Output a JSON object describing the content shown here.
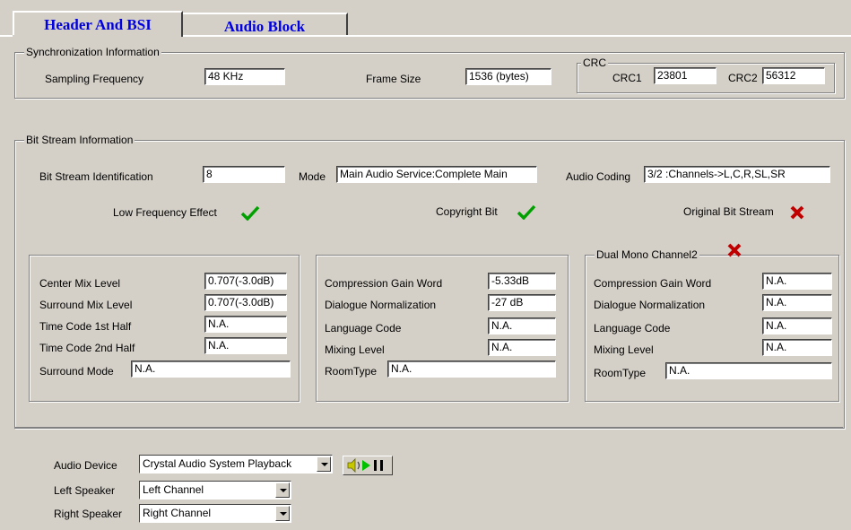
{
  "tabs": [
    {
      "label": "Header And BSI"
    },
    {
      "label": "Audio Block"
    }
  ],
  "sync": {
    "legend": "Synchronization  Information",
    "sampling_label": "Sampling Frequency",
    "sampling_value": "48 KHz",
    "frame_label": "Frame Size",
    "frame_value": "1536 (bytes)",
    "crc_legend": "CRC",
    "crc1_label": "CRC1",
    "crc1_value": "23801",
    "crc2_label": "CRC2",
    "crc2_value": "56312"
  },
  "bsi": {
    "legend": "Bit Stream Information",
    "bsid_label": "Bit Stream Identification",
    "bsid_value": "8",
    "mode_label": "Mode",
    "mode_value": "Main Audio Service:Complete Main",
    "coding_label": "Audio Coding",
    "coding_value": "3/2 :Channels->L,C,R,SL,SR",
    "lfe_label": "Low Frequency Effect",
    "copyright_label": "Copyright Bit",
    "original_label": "Original Bit Stream"
  },
  "mix": {
    "center_label": "Center Mix Level",
    "center_value": "0.707(-3.0dB)",
    "surround_label": "Surround Mix Level",
    "surround_value": "0.707(-3.0dB)",
    "tc1_label": "Time Code 1st Half",
    "tc1_value": "N.A.",
    "tc2_label": "Time Code 2nd Half",
    "tc2_value": "N.A.",
    "smode_label": "Surround Mode",
    "smode_value": "N.A."
  },
  "ch1": {
    "comp_label": "Compression Gain Word",
    "comp_value": "-5.33dB",
    "dialnorm_label": "Dialogue Normalization",
    "dialnorm_value": "-27  dB",
    "lang_label": "Language Code",
    "lang_value": "N.A.",
    "mixlvl_label": "Mixing Level",
    "mixlvl_value": "N.A.",
    "room_label": "RoomType",
    "room_value": "N.A."
  },
  "ch2": {
    "legend": "Dual Mono  Channel2",
    "comp_label": "Compression Gain Word",
    "comp_value": "N.A.",
    "dialnorm_label": "Dialogue Normalization",
    "dialnorm_value": "N.A.",
    "lang_label": "Language Code",
    "lang_value": "N.A.",
    "mixlvl_label": "Mixing Level",
    "mixlvl_value": "N.A.",
    "room_label": "RoomType",
    "room_value": "N.A."
  },
  "device": {
    "audio_label": "Audio Device",
    "audio_value": "Crystal Audio System Playback",
    "left_label": "Left Speaker",
    "left_value": "Left Channel",
    "right_label": "Right Speaker",
    "right_value": "Right Channel"
  },
  "icons": {
    "check_color": "#00a000",
    "cross_color": "#c00000",
    "tab_text_color": "#0000e0"
  }
}
